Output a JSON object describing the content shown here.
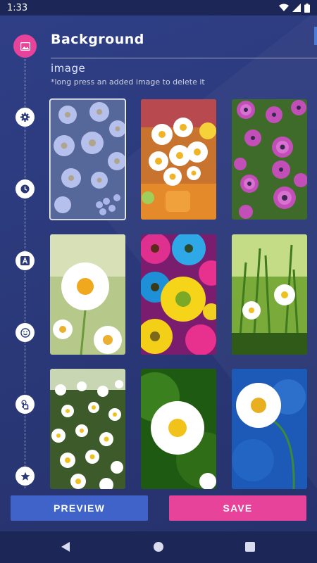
{
  "status_bar": {
    "time": "1:33"
  },
  "header": {
    "title": "Background",
    "section": "image",
    "hint": "*long press an added image to delete it"
  },
  "rail": {
    "items": [
      {
        "icon": "image-icon",
        "active": true
      },
      {
        "icon": "gear-icon",
        "active": false
      },
      {
        "icon": "clock-icon",
        "active": false
      },
      {
        "icon": "text-icon",
        "active": false
      },
      {
        "icon": "emoji-icon",
        "active": false
      },
      {
        "icon": "touch-icon",
        "active": false
      },
      {
        "icon": "star-icon",
        "active": false
      }
    ]
  },
  "gallery": {
    "images": [
      {
        "subject": "white daisies",
        "selected": true
      },
      {
        "subject": "daisy bouquet in vase"
      },
      {
        "subject": "purple osteospermum"
      },
      {
        "subject": "single white daisy"
      },
      {
        "subject": "colorful gerberas"
      },
      {
        "subject": "daisies in grass"
      },
      {
        "subject": "daisy field"
      },
      {
        "subject": "daisy on green"
      },
      {
        "subject": "daisy on blue"
      }
    ]
  },
  "buttons": {
    "preview": "PREVIEW",
    "save": "SAVE"
  },
  "colors": {
    "background": "#2a3878",
    "accent_pink": "#e8439a",
    "accent_blue": "#3f63c8",
    "status_bar": "#1d2757"
  }
}
